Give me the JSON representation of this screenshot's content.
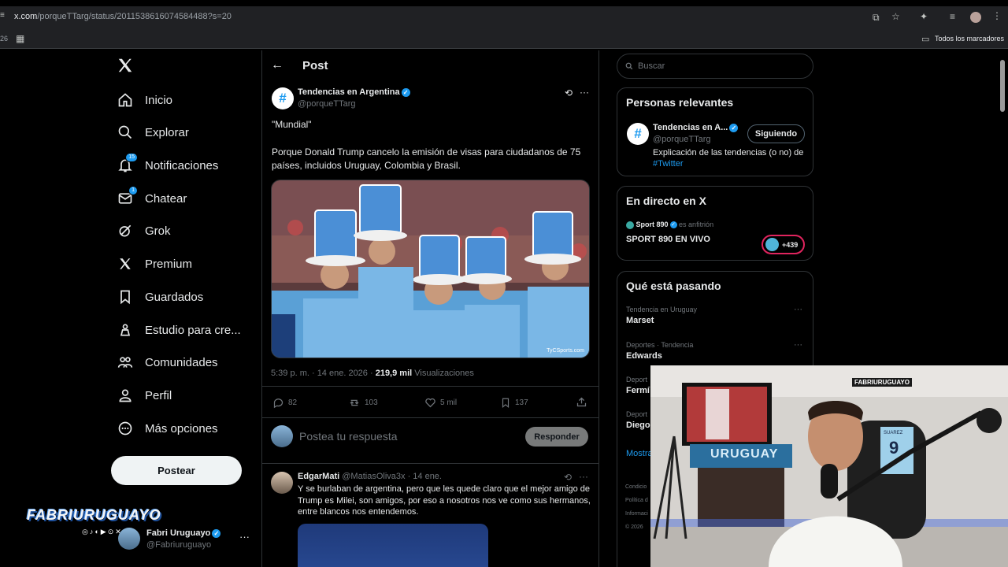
{
  "browser": {
    "url_host": "x.com",
    "url_path": "/porqueTTarg/status/2011538616074584488?s=20",
    "tab_fragment": "26",
    "bookmarks_label": "Todos los marcadores"
  },
  "nav": {
    "items": [
      {
        "label": "Inicio",
        "icon": "home-icon"
      },
      {
        "label": "Explorar",
        "icon": "search-icon"
      },
      {
        "label": "Notificaciones",
        "icon": "bell-icon",
        "badge": "15"
      },
      {
        "label": "Chatear",
        "icon": "mail-icon",
        "badge": "1"
      },
      {
        "label": "Grok",
        "icon": "grok-icon"
      },
      {
        "label": "Premium",
        "icon": "x-icon"
      },
      {
        "label": "Guardados",
        "icon": "bookmark-icon"
      },
      {
        "label": "Estudio para cre...",
        "icon": "studio-icon"
      },
      {
        "label": "Comunidades",
        "icon": "communities-icon"
      },
      {
        "label": "Perfil",
        "icon": "person-icon"
      },
      {
        "label": "Más opciones",
        "icon": "more-icon"
      }
    ],
    "post_button": "Postear"
  },
  "account": {
    "watermark": "FABRIURUGUAYO",
    "name": "Fabri Uruguayo",
    "handle": "@Fabriuruguayo"
  },
  "header": {
    "title": "Post"
  },
  "tweet": {
    "author": "Tendencias en Argentina",
    "handle": "@porqueTTarg",
    "line1": "\"Mundial\"",
    "line2": "Porque Donald Trump cancelo la emisión de visas para ciudadanos de 75 países, incluidos Uruguay, Colombia y Brasil.",
    "image_watermark": "TyCSports.com",
    "timestamp": "5:39 p. m. · 14 ene. 2026 · ",
    "views_count": "219,9 mil",
    "views_label": "Visualizaciones",
    "replies": "82",
    "reposts": "103",
    "likes": "5 mil",
    "bookmarks": "137"
  },
  "reply_box": {
    "placeholder": "Postea tu respuesta",
    "button": "Responder"
  },
  "reply": {
    "author": "EdgarMati",
    "handle": "@MatiasOliva3x",
    "date": "· 14 ene.",
    "text": "Y se burlaban de argentina, pero que les quede claro que el mejor amigo de Trump es Milei, son amigos, por eso a nosotros nos ve como sus hermanos, entre blancos nos entendemos."
  },
  "sidebar": {
    "search_placeholder": "Buscar",
    "relevant": {
      "title": "Personas relevantes",
      "name": "Tendencias en A...",
      "handle": "@porqueTTarg",
      "bio": "Explicación de las tendencias (o no) de",
      "hashtag": "#Twitter",
      "follow_button": "Siguiendo"
    },
    "live": {
      "title": "En directo en X",
      "host": "Sport 890",
      "host_suffix": "es anfitrión",
      "show": "SPORT 890 EN VIVO",
      "listeners": "+439"
    },
    "happening": {
      "title": "Qué está pasando",
      "trends": [
        {
          "context": "Tendencia en Uruguay",
          "name": "Marset"
        },
        {
          "context": "Deportes · Tendencia",
          "name": "Edwards"
        },
        {
          "context": "Deport",
          "name": "Fermí"
        },
        {
          "context": "Deport",
          "name": "Diego"
        }
      ],
      "show_more": "Mostra"
    },
    "footer": [
      "Condicio",
      "Política d",
      "Informaci",
      "© 2026"
    ]
  },
  "webcam": {
    "sign": "FABRIURUGUAYO",
    "shirt_label": "URUGUAY",
    "jersey_name": "SUAREZ",
    "jersey_number": "9"
  },
  "colors": {
    "accent": "#1d9bf0",
    "background": "#000000",
    "border": "#2f3336",
    "text": "#e7e9ea",
    "muted": "#71767b"
  }
}
